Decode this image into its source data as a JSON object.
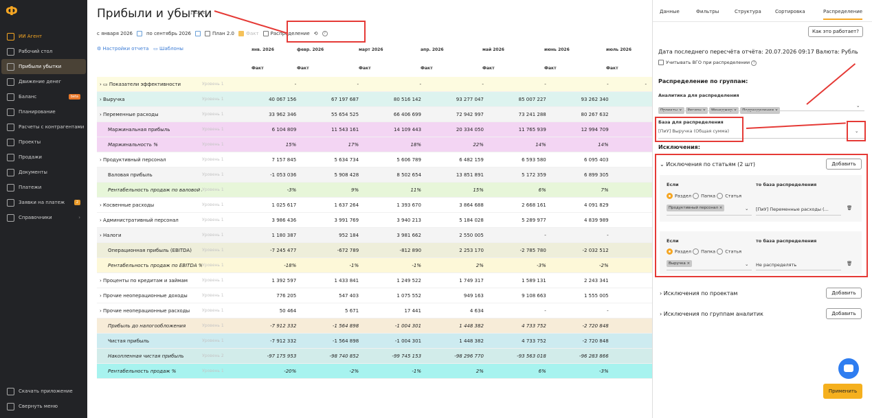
{
  "app": {
    "logo": "Ф"
  },
  "sidebar": {
    "items": [
      {
        "label": "ИИ Агент",
        "icon": "ai-agent-icon"
      },
      {
        "label": "Рабочий стол",
        "icon": "desktop-icon"
      },
      {
        "label": "Прибыли убытки",
        "icon": "chart-icon"
      },
      {
        "label": "Движение денег",
        "icon": "money-flow-icon"
      },
      {
        "label": "Баланс",
        "icon": "balance-icon",
        "badge": "beta"
      },
      {
        "label": "Планирование",
        "icon": "planning-icon"
      },
      {
        "label": "Расчеты с контрагентами",
        "icon": "contractors-icon"
      },
      {
        "label": "Проекты",
        "icon": "projects-icon"
      },
      {
        "label": "Продажи",
        "icon": "sales-icon"
      },
      {
        "label": "Документы",
        "icon": "documents-icon"
      },
      {
        "label": "Платежи",
        "icon": "payments-icon"
      },
      {
        "label": "Заявки на платеж",
        "icon": "requests-icon",
        "badge": "2"
      },
      {
        "label": "Справочники",
        "icon": "directories-icon",
        "chevron": "›"
      }
    ],
    "bottom": [
      {
        "label": "Скачать приложение",
        "icon": "mobile-icon"
      },
      {
        "label": "Свернуть меню",
        "icon": "collapse-icon"
      }
    ]
  },
  "header": {
    "title": "Прибыли и убытки",
    "excel": "Excel",
    "excel_icon": "download-icon"
  },
  "filters": {
    "from": "с января 2026",
    "to": "по сентябрь 2026",
    "plan": "План 2.0",
    "fact": "Факт",
    "distribution": "Распределение"
  },
  "report": {
    "settings": "Настройки отчета",
    "templates": "Шаблоны"
  },
  "table": {
    "months": [
      "янв. 2026",
      "февр. 2026",
      "март 2026",
      "апр. 2026",
      "май 2026",
      "июнь 2026",
      "июль 2026"
    ],
    "sub": [
      "Факт",
      "Факт",
      "Факт",
      "Факт",
      "Факт",
      "Факт",
      "Факт"
    ],
    "rows": [
      {
        "label": "Показатели эффективности",
        "level": "Уровень 1",
        "bg": "#fdfbe0",
        "expand": true,
        "folder": true,
        "values": [
          "-",
          "-",
          "-",
          "-",
          "-",
          "-",
          "-"
        ]
      },
      {
        "label": "Выручка",
        "level": "Уровень 1",
        "bg": "#ddf3ef",
        "expand": true,
        "values": [
          "40 067 156",
          "67 197 687",
          "80 516 142",
          "93 277 047",
          "85 007 227",
          "93 262 340",
          ""
        ]
      },
      {
        "label": "Переменные расходы",
        "level": "Уровень 1",
        "bg": "#f4f4f4",
        "expand": true,
        "values": [
          "33 962 346",
          "55 654 525",
          "66 406 699",
          "72 942 997",
          "73 241 288",
          "80 267 632",
          ""
        ]
      },
      {
        "label": "Маржинальная прибыль",
        "level": "Уровень 1",
        "bg": "#f3d5f3",
        "values": [
          "6 104 809",
          "11 543 161",
          "14 109 443",
          "20 334 050",
          "11 765 939",
          "12 994 709",
          ""
        ]
      },
      {
        "label": "Маржинальность %",
        "level": "Уровень 1",
        "bg": "#f3d5f3",
        "italic": true,
        "values": [
          "15%",
          "17%",
          "18%",
          "22%",
          "14%",
          "14%",
          ""
        ]
      },
      {
        "label": "Продуктивный персонал",
        "level": "Уровень 1",
        "bg": "#ffffff",
        "expand": true,
        "values": [
          "7 157 845",
          "5 634 734",
          "5 606 789",
          "6 482 159",
          "6 593 580",
          "6 095 403",
          ""
        ]
      },
      {
        "label": "Валовая прибыль",
        "level": "Уровень 1",
        "bg": "#f4f4f4",
        "values": [
          "-1 053 036",
          "5 908 428",
          "8 502 654",
          "13 851 891",
          "5 172 359",
          "6 899 305",
          ""
        ]
      },
      {
        "label": "Рентабельность продаж по валовой приб...",
        "level": "Уровень 1",
        "bg": "#e7f6d9",
        "italic": true,
        "values": [
          "-3%",
          "9%",
          "11%",
          "15%",
          "6%",
          "7%",
          ""
        ]
      },
      {
        "label": "Косвенные расходы",
        "level": "Уровень 1",
        "bg": "#ffffff",
        "expand": true,
        "values": [
          "1 025 617",
          "1 637 264",
          "1 393 670",
          "3 864 688",
          "2 668 161",
          "4 091 829",
          ""
        ]
      },
      {
        "label": "Административный персонал",
        "level": "Уровень 1",
        "bg": "#ffffff",
        "expand": true,
        "values": [
          "3 986 436",
          "3 991 769",
          "3 940 213",
          "5 184 028",
          "5 289 977",
          "4 839 989",
          ""
        ]
      },
      {
        "label": "Налоги",
        "level": "Уровень 1",
        "bg": "#f4f4f4",
        "expand": true,
        "values": [
          "1 180 387",
          "952 184",
          "3 981 662",
          "2 550 005",
          "-",
          "-",
          ""
        ]
      },
      {
        "label": "Операционная прибыль (EBITDA)",
        "level": "Уровень 1",
        "bg": "#eeeeda",
        "values": [
          "-7 245 477",
          "-672 789",
          "-812 890",
          "2 253 170",
          "-2 785 780",
          "-2 032 512",
          ""
        ]
      },
      {
        "label": "Рентабельность продаж по EBITDA %",
        "level": "Уровень 1",
        "bg": "#fdf8d8",
        "italic": true,
        "values": [
          "-18%",
          "-1%",
          "-1%",
          "2%",
          "-3%",
          "-2%",
          ""
        ]
      },
      {
        "label": "Проценты по кредитам и займам",
        "level": "Уровень 1",
        "bg": "#ffffff",
        "expand": true,
        "values": [
          "1 392 597",
          "1 433 841",
          "1 249 522",
          "1 749 317",
          "1 589 131",
          "2 243 341",
          ""
        ]
      },
      {
        "label": "Прочие неоперационные доходы",
        "level": "Уровень 1",
        "bg": "#ffffff",
        "expand": true,
        "values": [
          "776 205",
          "547 403",
          "1 075 552",
          "949 163",
          "9 108 663",
          "1 555 005",
          ""
        ]
      },
      {
        "label": "Прочие неоперационные расходы",
        "level": "Уровень 1",
        "bg": "#ffffff",
        "expand": true,
        "values": [
          "50 464",
          "5 671",
          "17 441",
          "4 634",
          "-",
          "-",
          ""
        ]
      },
      {
        "label": "Прибыль до налогообложения",
        "level": "Уровень 1",
        "bg": "#f7ecd8",
        "italic": true,
        "values": [
          "-7 912 332",
          "-1 564 898",
          "-1 004 301",
          "1 448 382",
          "4 733 752",
          "-2 720 848",
          ""
        ]
      },
      {
        "label": "Чистая прибыль",
        "level": "Уровень 1",
        "bg": "#cdebf0",
        "values": [
          "-7 912 332",
          "-1 564 898",
          "-1 004 301",
          "1 448 382",
          "4 733 752",
          "-2 720 848",
          ""
        ]
      },
      {
        "label": "Накопленная чистая прибыль",
        "level": "Уровень 2",
        "bg": "#d2ecea",
        "italic": true,
        "values": [
          "-97 175 953",
          "-98 740 852",
          "-99 745 153",
          "-98 296 770",
          "-93 563 018",
          "-96 283 866",
          ""
        ]
      },
      {
        "label": "Рентабельность продаж %",
        "level": "Уровень 1",
        "bg": "#a7f3ef",
        "italic": true,
        "values": [
          "-20%",
          "-2%",
          "-1%",
          "2%",
          "6%",
          "-3%",
          ""
        ]
      }
    ]
  },
  "panel": {
    "tabs": [
      "Данные",
      "Фильтры",
      "Структура",
      "Сортировка",
      "Распределение"
    ],
    "how_button": "Как это работает?",
    "recalc": "Дата последнего пересчёта отчёта: 20.07.2026 09:17 Валюта: Рубль",
    "vgo": "Учитывать ВГО при распределении",
    "groups_title": "Распределение по группам:",
    "analytics_label": "Аналитика для распределения",
    "chips": [
      "Проекты",
      "Регион",
      "Менеджер",
      "Подразделения"
    ],
    "base_label": "База для распределения",
    "base_value": "[ПиУ] Выручка (Общая сумма)",
    "exclusions_title": "Исключения:",
    "by_articles": "Исключения по статьям (2 шт)",
    "add": "Добавить",
    "if": "Если",
    "then_base": "то база распределения",
    "radio": [
      "Раздел",
      "Папка",
      "Статья"
    ],
    "rule1_chip": "Продуктивный персонал",
    "rule1_base": "[ПиУ] Переменные расходы (...",
    "rule2_chip": "Выручка",
    "rule2_base": "Не распределять",
    "by_projects": "Исключения по проектам",
    "by_groups": "Исключения по группам аналитик",
    "apply": "Применить"
  }
}
